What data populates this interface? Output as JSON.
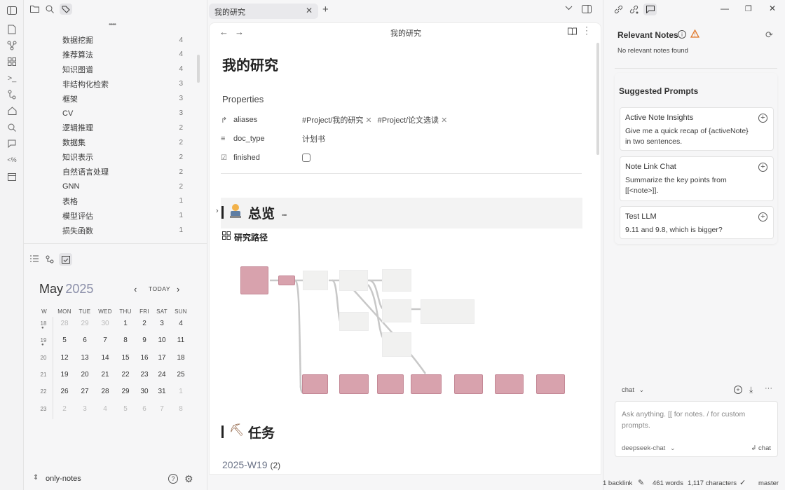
{
  "ribbon": {
    "icons": [
      "sidebar-toggle-icon",
      "file-icon",
      "graph-icon",
      "grid-icon",
      "terminal-icon",
      "git-icon",
      "home-icon",
      "search-icon",
      "chat-icon",
      "percent-code-icon",
      "calendar-icon"
    ]
  },
  "left": {
    "tags": [
      {
        "name": "数据挖掘",
        "count": "4"
      },
      {
        "name": "推荐算法",
        "count": "4"
      },
      {
        "name": "知识图谱",
        "count": "4"
      },
      {
        "name": "非结构化检索",
        "count": "3"
      },
      {
        "name": "框架",
        "count": "3"
      },
      {
        "name": "CV",
        "count": "3"
      },
      {
        "name": "逻辑推理",
        "count": "2"
      },
      {
        "name": "数据集",
        "count": "2"
      },
      {
        "name": "知识表示",
        "count": "2"
      },
      {
        "name": "自然语言处理",
        "count": "2"
      },
      {
        "name": "GNN",
        "count": "2"
      },
      {
        "name": "表格",
        "count": "1"
      },
      {
        "name": "模型评估",
        "count": "1"
      },
      {
        "name": "损失函数",
        "count": "1"
      }
    ],
    "calendar": {
      "month": "May",
      "year": "2025",
      "today": "TODAY",
      "headers": [
        "W",
        "MON",
        "TUE",
        "WED",
        "THU",
        "FRI",
        "SAT",
        "SUN"
      ],
      "weeks": [
        {
          "w": "18",
          "days": [
            "28",
            "29",
            "30",
            "1",
            "2",
            "3",
            "4"
          ]
        },
        {
          "w": "19",
          "days": [
            "5",
            "6",
            "7",
            "8",
            "9",
            "10",
            "11"
          ]
        },
        {
          "w": "20",
          "days": [
            "12",
            "13",
            "14",
            "15",
            "16",
            "17",
            "18"
          ]
        },
        {
          "w": "21",
          "days": [
            "19",
            "20",
            "21",
            "22",
            "23",
            "24",
            "25"
          ]
        },
        {
          "w": "22",
          "days": [
            "26",
            "27",
            "28",
            "29",
            "30",
            "31",
            "1"
          ]
        },
        {
          "w": "23",
          "days": [
            "2",
            "3",
            "4",
            "5",
            "6",
            "7",
            "8"
          ]
        }
      ]
    },
    "vault": "only-notes"
  },
  "tab": {
    "title": "我的研究"
  },
  "editor": {
    "header_title": "我的研究",
    "title": "我的研究",
    "properties_label": "Properties",
    "props": [
      {
        "key": "aliases",
        "values": [
          "#Project/我的研究",
          "#Project/论文选读"
        ]
      },
      {
        "key": "doc_type",
        "value": "计划书"
      },
      {
        "key": "finished",
        "value": ""
      }
    ],
    "overview_heading": "总览",
    "overview_ellipsis": "•••",
    "path_heading": "研究路径",
    "task_heading": "任务",
    "week_heading": "2025-W19",
    "week_count": "(2)"
  },
  "right": {
    "relevant_title": "Relevant Notes",
    "no_notes": "No relevant notes found",
    "suggested_title": "Suggested Prompts",
    "prompts": [
      {
        "title": "Active Note Insights",
        "desc": "Give me a quick recap of {activeNote} in two sentences."
      },
      {
        "title": "Note Link Chat",
        "desc": "Summarize the key points from [[<note>]]."
      },
      {
        "title": "Test LLM",
        "desc": "9.11 and 9.8, which is bigger?"
      }
    ],
    "mode": "chat",
    "input_placeholder": "Ask anything. [[ for notes. / for custom prompts.",
    "model": "deepseek-chat",
    "send_label": "chat"
  },
  "status": {
    "backlinks": "1 backlink",
    "words": "461 words",
    "chars": "1,117 characters",
    "branch": "master"
  },
  "colors": {
    "pink": "#d8a2ad",
    "accent": "#e0772a"
  }
}
